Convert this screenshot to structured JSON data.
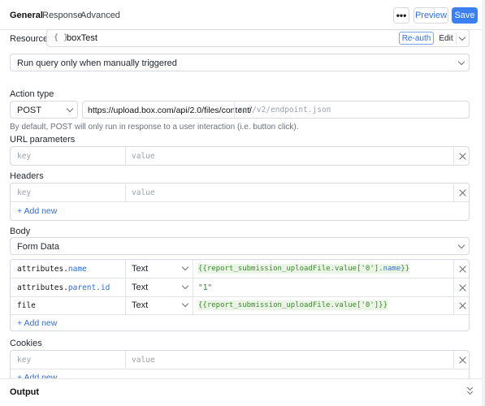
{
  "tabs": [
    {
      "label": "General"
    },
    {
      "label": "Response"
    },
    {
      "label": "Advanced"
    }
  ],
  "toolbar": {
    "more_label": "•••",
    "preview_label": "Preview",
    "save_label": "Save"
  },
  "resource": {
    "label": "Resource",
    "icon_glyph": "{ }",
    "name": "boxTest",
    "reauth_label": "Re-auth",
    "edit_label": "Edit"
  },
  "trigger": {
    "value": "Run query only when manually triggered"
  },
  "action": {
    "label": "Action type",
    "method": "POST",
    "url_base": "https://upload.box.com/api/2.0/files/content/",
    "url_placeholder": "api/v2/endpoint.json",
    "hint": "By default, POST will only run in response to a user interaction (i.e. button click)."
  },
  "url_params": {
    "label": "URL parameters",
    "key_placeholder": "key",
    "value_placeholder": "value"
  },
  "headers": {
    "label": "Headers",
    "key_placeholder": "key",
    "value_placeholder": "value",
    "add_label": "+ Add new"
  },
  "body": {
    "label": "Body",
    "type": "Form Data",
    "rows": [
      {
        "key_prefix": "attributes.",
        "key_suffix": "name",
        "type": "Text",
        "value_open": "{{",
        "value_main": "report_submission_uploadFile.value['0'].",
        "value_accent": "name",
        "value_close": "}}"
      },
      {
        "key_prefix": "attributes.",
        "key_suffix": "parent.id",
        "type": "Text",
        "value_string": "\"1\""
      },
      {
        "key_prefix": "file",
        "key_suffix": "",
        "type": "Text",
        "value_open": "{{",
        "value_main": "report_submission_uploadFile.value['0']",
        "value_accent": "",
        "value_close": "}}"
      }
    ],
    "add_label": "+ Add new"
  },
  "cookies": {
    "label": "Cookies",
    "key_placeholder": "key",
    "value_placeholder": "value",
    "add_label": "+ Add new"
  },
  "output": {
    "label": "Output"
  }
}
